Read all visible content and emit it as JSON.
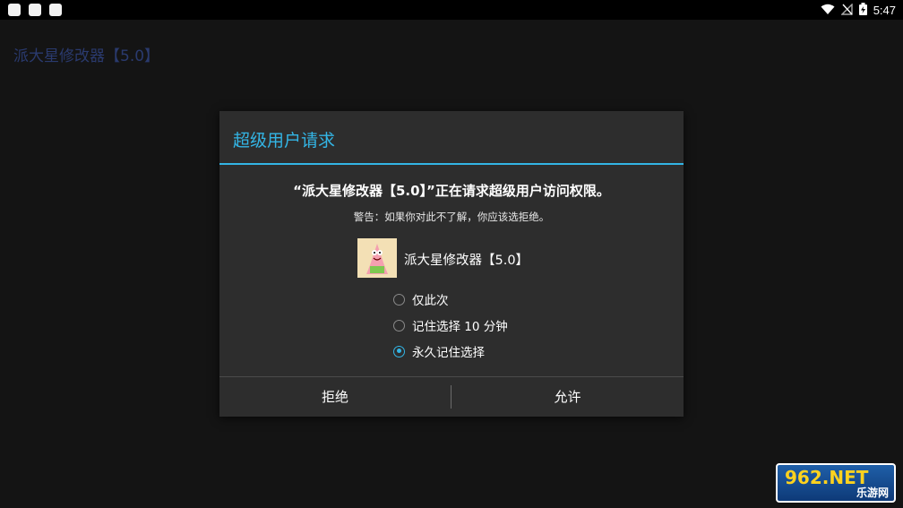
{
  "status_bar": {
    "notification_icons": [
      "notification-icon",
      "notification-icon",
      "notification-icon"
    ],
    "right_icons": [
      "wifi-icon",
      "no-signal-icon",
      "battery-charging-icon"
    ],
    "time": "5:47"
  },
  "app": {
    "title": "派大星修改器【5.0】"
  },
  "dialog": {
    "title": "超级用户请求",
    "request_message": "“派大星修改器【5.0】”正在请求超级用户访问权限。",
    "warning": "警告：如果你对此不了解，你应该选拒绝。",
    "app_name": "派大星修改器【5.0】",
    "options": [
      {
        "label": "仅此次",
        "checked": false
      },
      {
        "label": "记住选择 10 分钟",
        "checked": false
      },
      {
        "label": "永久记住选择",
        "checked": true
      }
    ],
    "deny_label": "拒绝",
    "allow_label": "允许",
    "accent_color": "#33b5e5"
  },
  "watermark": {
    "main": "962.NET",
    "sub": "乐游网"
  }
}
